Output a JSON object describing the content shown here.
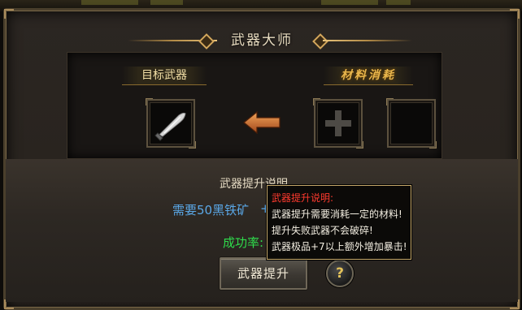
{
  "window": {
    "title": "武器大师"
  },
  "target": {
    "label": "目标武器",
    "slot_item": "sword-item-icon"
  },
  "material": {
    "label": "材料消耗",
    "slots": [
      "empty-plus-slot",
      "empty-slot"
    ]
  },
  "upgrade": {
    "title": "武器提升说明",
    "requirement": "需要50黑铁矿",
    "requirement_suffix": "+",
    "success_label": "成功率:",
    "button_label": "武器提升",
    "help_label": "?"
  },
  "tooltip": {
    "title": "武器提升说明:",
    "lines": [
      "武器提升需要消耗一定的材料!",
      "提升失败武器不会破碎!",
      "武器极品+7以上额外增加暴击!"
    ]
  },
  "colors": {
    "requirement": "#5aa7e6",
    "success": "#2fdc4c",
    "tooltip_title": "#ff3a2e",
    "material_label": "#e9b64c"
  }
}
